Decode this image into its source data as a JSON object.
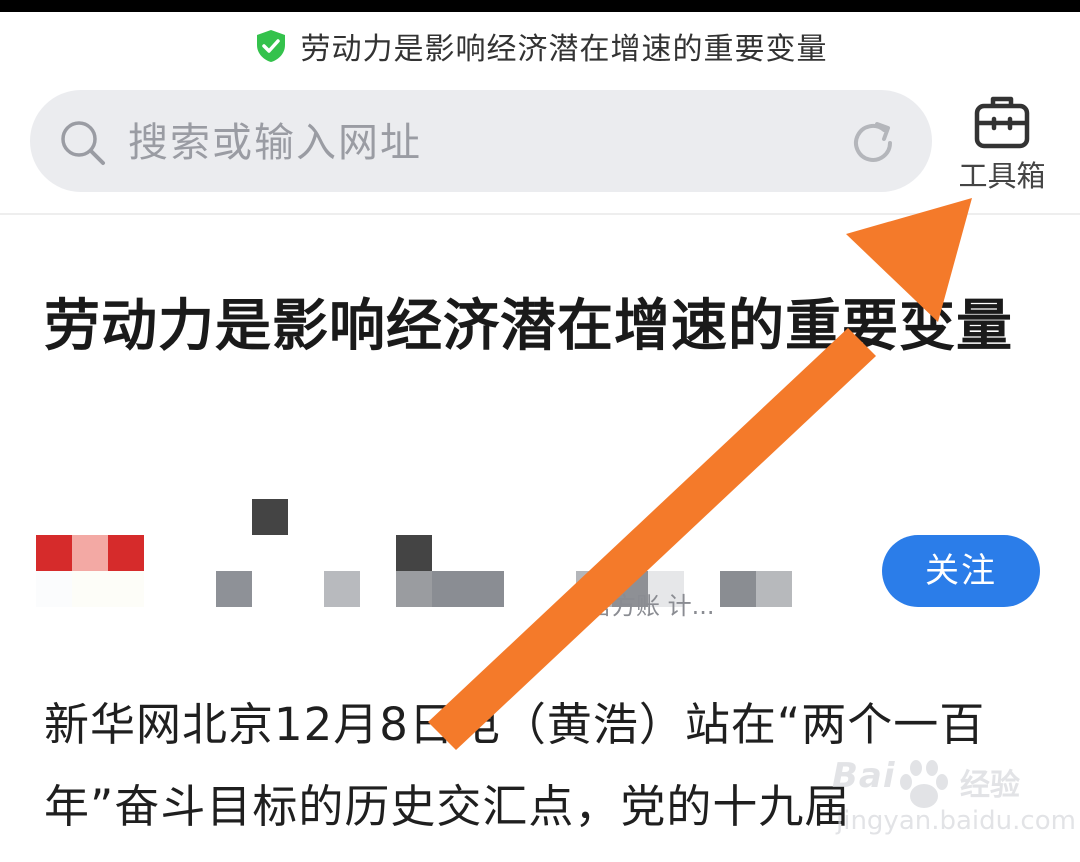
{
  "status_bar": {},
  "site": {
    "title": "劳动力是影响经济潜在增速的重要变量",
    "secure_icon": "shield-check-icon",
    "secure_color": "#34c24c"
  },
  "search": {
    "placeholder": "搜索或输入网址",
    "icon": "search-icon",
    "refresh_icon": "refresh-icon"
  },
  "toolbox": {
    "label": "工具箱",
    "icon": "briefcase-icon"
  },
  "article": {
    "title": "劳动力是影响经济潜在增速的重要变量",
    "author_meta_visible": "官方账 计...",
    "follow_label": "关注",
    "body": "新华网北京12月8日电（黄浩）站在“两个一百年”奋斗目标的历史交汇点，党的十九届"
  },
  "annotation": {
    "arrow_color": "#f47a2a",
    "points_to": "toolbox-button"
  },
  "watermark": {
    "brand": "Bai",
    "brand2": "经验",
    "url": "jingyan.baidu.com"
  },
  "colors": {
    "accent": "#2b7de9",
    "search_bg": "#ebecef"
  }
}
